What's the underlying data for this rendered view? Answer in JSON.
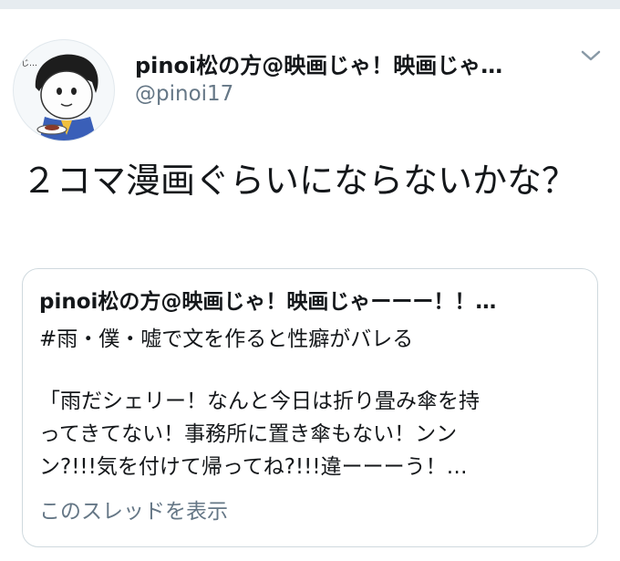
{
  "tweet": {
    "display_name": "pinoi松の方@映画じゃ！映画じゃ…",
    "handle": "@pinoi17",
    "avatar_icon": "user-avatar-icon",
    "more_icon": "chevron-down-icon",
    "text": "２コマ漫画ぐらいにならないかな？"
  },
  "quote": {
    "author": "pinoi松の方@映画じゃ！映画じゃーーー！！…",
    "hashtag": "#雨・僕・嘘で文を作ると性癖がバレる",
    "body_lines": [
      "「雨だシェリー！なんと今日は折り畳み傘を持",
      "ってきてない！事務所に置き傘もない！ンン",
      "ン?!!!気を付けて帰ってね?!!!違ーーーう！…"
    ],
    "show_thread": "このスレッドを表示"
  },
  "colors": {
    "text_primary": "#14171a",
    "text_secondary": "#657786",
    "border": "#cfd9de",
    "divider": "#e6ecf0"
  }
}
